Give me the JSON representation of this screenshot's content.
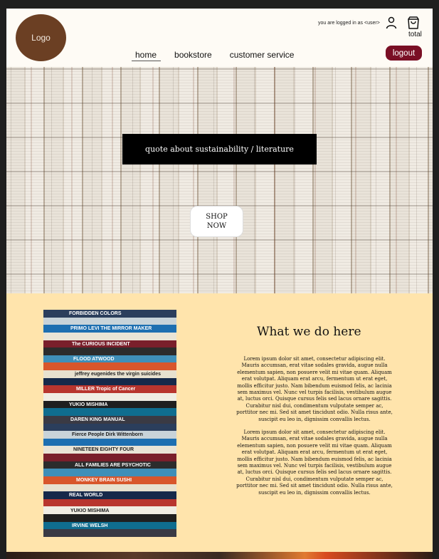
{
  "header": {
    "logo_label": "Logo",
    "nav": [
      {
        "label": "home",
        "active": true
      },
      {
        "label": "bookstore",
        "active": false
      },
      {
        "label": "customer service",
        "active": false
      }
    ],
    "logged_in_text": "you are logged in as <user>",
    "cart_label": "total",
    "logout_label": "logout",
    "icons": {
      "user": "user-icon",
      "cart": "shopping-bag-icon"
    },
    "colors": {
      "logo": "#6b3f23",
      "logout": "#7a0f25",
      "background": "#fefbf5"
    }
  },
  "hero": {
    "quote": "quote about sustainability / literature",
    "shop_label": "SHOP NOW"
  },
  "about": {
    "title": "What we do here",
    "paragraphs": [
      "Lorem ipsum dolor sit amet, consectetur adipiscing elit. Mauris accumsan, erat vitae sodales gravida, augue nulla elementum sapien, non posuere velit mi vitae quam. Aliquam erat volutpat. Aliquam erat arcu, fermentum ut erat eget, mollis efficitur justo. Nam bibendum euismod felis, ac lacinia sem maximus vel. Nunc vel turpis facilisis, vestibulum augue at, luctus orci. Quisque cursus felis sed lacus ornare sagittis. Curabitur nisl dui, condimentum vulputate semper ac, porttitor nec mi. Sed sit amet tincidunt odio. Nulla risus ante, suscipit eu leo in, dignissim convallis lectus.",
      "Lorem ipsum dolor sit amet, consectetur adipiscing elit. Mauris accumsan, erat vitae sodales gravida, augue nulla elementum sapien, non posuere velit mi vitae quam. Aliquam erat volutpat. Aliquam erat arcu, fermentum ut erat eget, mollis efficitur justo. Nam bibendum euismod felis, ac lacinia sem maximus vel. Nunc vel turpis facilisis, vestibulum augue at, luctus orci. Quisque cursus felis sed lacus ornare sagittis. Curabitur nisl dui, condimentum vulputate semper ac, porttitor nec mi. Sed sit amet tincidunt odio. Nulla risus ante, suscipit eu leo in, dignissim convallis lectus."
    ],
    "background_color": "#ffe4ac",
    "book_spines": [
      "FORBIDDEN COLORS",
      "PRIMO LEVI   THE MIRROR MAKER",
      "The CURIOUS INCIDENT",
      "FLOOD   ATWOOD",
      "jeffrey eugenides   the virgin suicides",
      "MILLER  Tropic of Cancer",
      "YUKIO MISHIMA",
      "DAREN KING   MANUAL",
      "Fierce People   Dirk Wittenborn",
      "NINETEEN EIGHTY FOUR",
      "ALL FAMILIES ARE PSYCHOTIC",
      "MONKEY BRAIN SUSHI",
      "REAL WORLD",
      "YUKIO MISHIMA",
      "IRVINE WELSH"
    ]
  }
}
